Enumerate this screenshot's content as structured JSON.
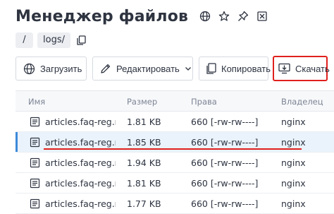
{
  "header": {
    "title": "Менеджер файлов",
    "icons": [
      "globe-icon",
      "star-icon",
      "pin-icon",
      "excel-icon"
    ]
  },
  "breadcrumb": {
    "root": "/",
    "folder": "logs/",
    "copy_icon": "copy-icon"
  },
  "toolbar": {
    "upload_label": "Загрузить",
    "edit_label": "Редактировать",
    "copy_label": "Копировать",
    "download_label": "Скачать",
    "highlight_color": "#e0201d"
  },
  "table": {
    "columns": [
      "Имя",
      "Размер",
      "Права",
      "Владелец"
    ],
    "rows": [
      {
        "name": "articles.faq-reg.r...",
        "size": "1.81 KB",
        "perms": "660 [-rw-rw----]",
        "owner": "nginx",
        "selected": false
      },
      {
        "name": "articles.faq-reg.r...",
        "size": "1.85 KB",
        "perms": "660 [-rw-rw----]",
        "owner": "nginx",
        "selected": true
      },
      {
        "name": "articles.faq-reg.r...",
        "size": "1.94 KB",
        "perms": "660 [-rw-rw----]",
        "owner": "nginx",
        "selected": false
      },
      {
        "name": "articles.faq-reg.r...",
        "size": "1.81 KB",
        "perms": "660 [-rw-rw----]",
        "owner": "nginx",
        "selected": false
      },
      {
        "name": "articles.faq-reg.r...",
        "size": "1.77 KB",
        "perms": "660 [-rw-rw----]",
        "owner": "nginx",
        "selected": false
      }
    ],
    "selected_color": "#3b8ad9"
  }
}
